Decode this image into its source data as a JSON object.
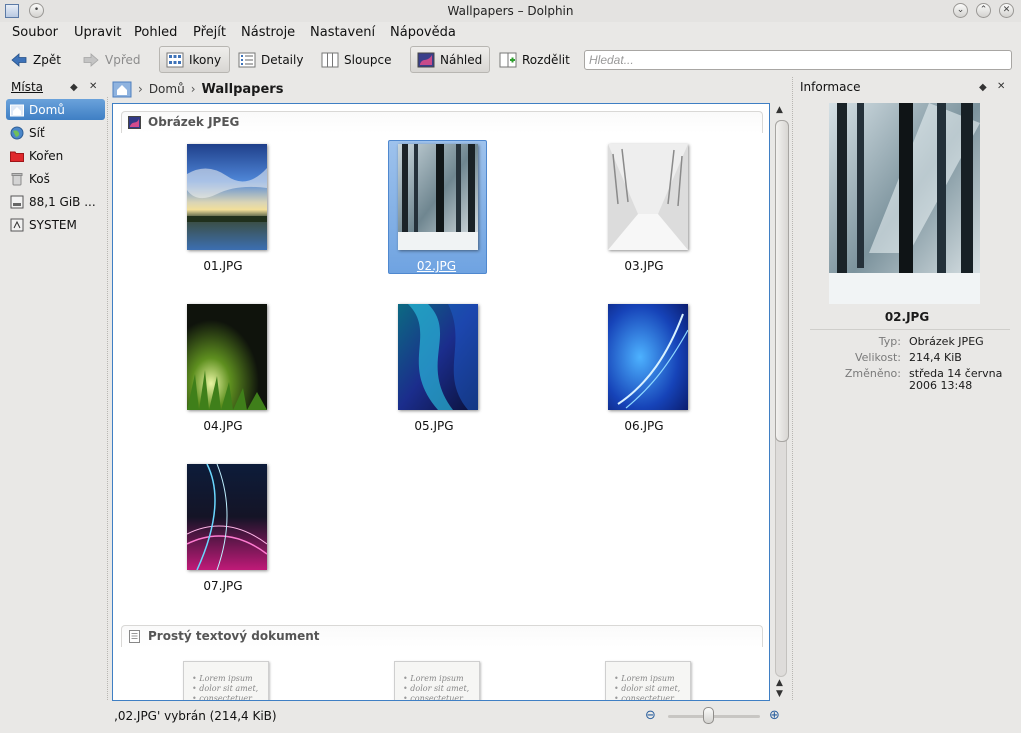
{
  "window": {
    "title": "Wallpapers – Dolphin"
  },
  "menu": [
    "Soubor",
    "Upravit",
    "Pohled",
    "Přejít",
    "Nástroje",
    "Nastavení",
    "Nápověda"
  ],
  "toolbar": {
    "back": "Zpět",
    "forward": "Vpřed",
    "icons": "Ikony",
    "details": "Detaily",
    "columns": "Sloupce",
    "preview": "Náhled",
    "split": "Rozdělit",
    "search_placeholder": "Hledat..."
  },
  "places": {
    "title": "Místa",
    "items": [
      {
        "label": "Domů",
        "icon": "home-icon",
        "selected": true
      },
      {
        "label": "Síť",
        "icon": "network-icon"
      },
      {
        "label": "Kořen",
        "icon": "folder-red-icon"
      },
      {
        "label": "Koš",
        "icon": "trash-icon"
      },
      {
        "label": "88,1 GiB ...",
        "icon": "drive-icon"
      },
      {
        "label": "SYSTEM",
        "icon": "drive-icon"
      }
    ]
  },
  "breadcrumb": {
    "parent": "Domů",
    "current": "Wallpapers"
  },
  "groups": {
    "jpeg": "Obrázek JPEG",
    "text": "Prostý textový dokument"
  },
  "files": [
    {
      "name": "01.JPG"
    },
    {
      "name": "02.JPG",
      "selected": true
    },
    {
      "name": "03.JPG"
    },
    {
      "name": "04.JPG"
    },
    {
      "name": "05.JPG"
    },
    {
      "name": "06.JPG"
    },
    {
      "name": "07.JPG"
    }
  ],
  "textdoc_lines": [
    "Lorem ipsum",
    "dolor sit amet,",
    "consectetuer"
  ],
  "info": {
    "title": "Informace",
    "filename": "02.JPG",
    "type_key": "Typ:",
    "type_val": "Obrázek JPEG",
    "size_key": "Velikost:",
    "size_val": "214,4 KiB",
    "modified_key": "Změněno:",
    "modified_val1": "středa 14 června",
    "modified_val2": "2006 13:48"
  },
  "status": {
    "text": "‚02.JPG' vybrán (214,4 KiB)"
  },
  "colors": {
    "selection": "#3f7fc4",
    "accent": "#6aa2db"
  }
}
